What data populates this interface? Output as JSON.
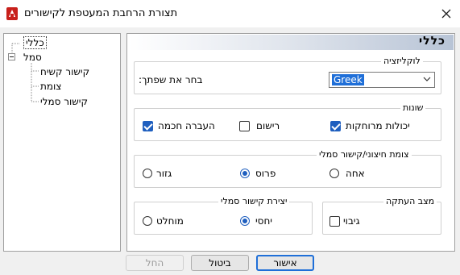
{
  "window": {
    "title": "תצורת הרחבת המעטפת לקישורים",
    "app_icon": "cad-app-icon",
    "close_icon": "close-icon"
  },
  "tree": {
    "items": [
      {
        "label": "כללי",
        "selected": true
      },
      {
        "label": "סמל",
        "expanded": true
      },
      {
        "label": "קישור קשיח"
      },
      {
        "label": "צומת"
      },
      {
        "label": "קישור סמלי"
      }
    ]
  },
  "panel": {
    "header": "כללי",
    "localization": {
      "legend": "לוקליזציה",
      "language_label": "בחר את שפתך:",
      "language_value": "Greek"
    },
    "misc": {
      "legend": "שונות",
      "smart_move": {
        "label": "העברה חכמה",
        "checked": true
      },
      "logging": {
        "label": "רישום",
        "checked": false
      },
      "remote": {
        "label": "יכולות מרוחקות",
        "checked": true
      }
    },
    "junction": {
      "legend": "צומת חיצוני/קישור סמלי",
      "cut": {
        "label": "גזור",
        "checked": false
      },
      "unroll": {
        "label": "פרוס",
        "checked": true
      },
      "unify": {
        "label": "אחה",
        "checked": false
      }
    },
    "symlink_create": {
      "legend": "יצירת קישור סמלי",
      "absolute": {
        "label": "מוחלט",
        "checked": false
      },
      "relative": {
        "label": "יחסי",
        "checked": true
      }
    },
    "copy_mode": {
      "legend": "מצב העתקה",
      "backup": {
        "label": "גיבוי",
        "checked": false
      }
    }
  },
  "buttons": {
    "ok": "אישור",
    "cancel": "ביטול",
    "apply": "החל"
  },
  "colors": {
    "accent": "#1f6fd8",
    "check": "#1f5fbf"
  }
}
